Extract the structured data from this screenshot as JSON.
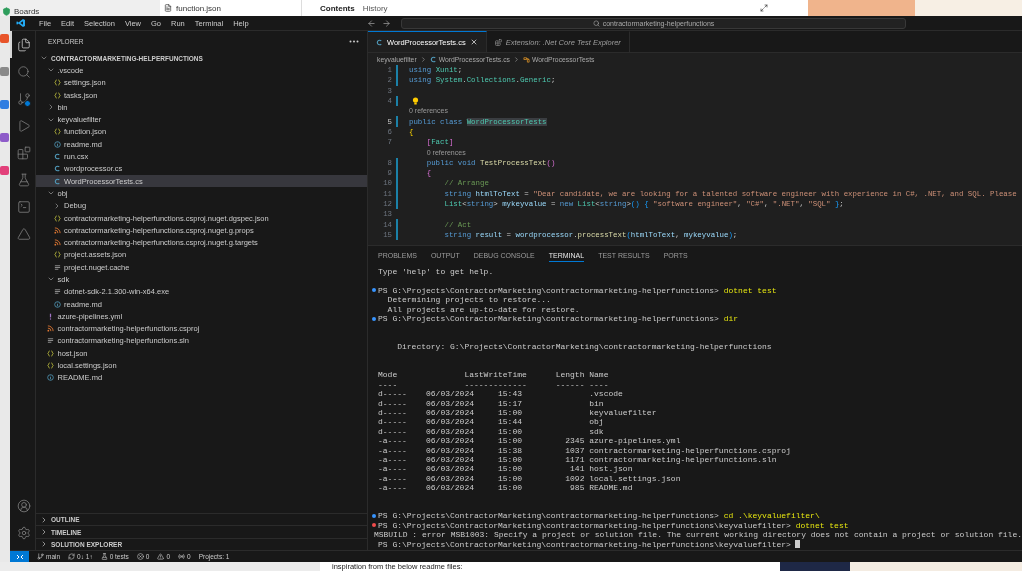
{
  "background": {
    "top_left": "Boards",
    "file_tab": "function.json",
    "tabs": [
      {
        "label": "Contents",
        "selected": true
      },
      {
        "label": "History",
        "selected": false
      }
    ],
    "bottom_text": "inspiration from the below readme files:"
  },
  "menu": [
    "File",
    "Edit",
    "Selection",
    "View",
    "Go",
    "Run",
    "Terminal",
    "Help"
  ],
  "command_center": "contractormarketing-helperfunctions",
  "activity_bar": [
    {
      "kind": "explorer",
      "selected": true
    },
    {
      "kind": "search",
      "selected": false
    },
    {
      "kind": "source_control",
      "selected": false
    },
    {
      "kind": "run",
      "selected": false
    },
    {
      "kind": "extensions",
      "selected": false
    },
    {
      "kind": "testing",
      "selected": false
    },
    {
      "kind": "terminal",
      "selected": false
    },
    {
      "kind": "azure",
      "selected": false
    }
  ],
  "activity_bar_bottom": [
    {
      "kind": "accounts"
    },
    {
      "kind": "settings"
    }
  ],
  "explorer": {
    "title": "EXPLORER",
    "tree": [
      {
        "kind": "root",
        "name": "CONTRACTORMARKETING-HELPERFUNCTIONS",
        "expanded": true,
        "selected": false,
        "children": [
          {
            "kind": "folder",
            "name": ".vscode",
            "expanded": true,
            "selected": false,
            "children": [
              {
                "kind": "json",
                "name": "settings.json",
                "selected": false
              },
              {
                "kind": "json",
                "name": "tasks.json",
                "selected": false
              }
            ]
          },
          {
            "kind": "folder",
            "name": "bin",
            "expanded": false,
            "selected": false
          },
          {
            "kind": "folder",
            "name": "keyvaluefilter",
            "expanded": true,
            "selected": false,
            "children": [
              {
                "kind": "json",
                "name": "function.json",
                "selected": false
              },
              {
                "kind": "info",
                "name": "readme.md",
                "selected": false
              },
              {
                "kind": "csharp",
                "name": "run.csx",
                "selected": false
              },
              {
                "kind": "csharp",
                "name": "wordprocessor.cs",
                "selected": false
              },
              {
                "kind": "csharp",
                "name": "WordProcessorTests.cs",
                "selected": true
              }
            ]
          },
          {
            "kind": "folder",
            "name": "obj",
            "expanded": true,
            "selected": false,
            "children": [
              {
                "kind": "folder",
                "name": "Debug",
                "expanded": false,
                "selected": false
              },
              {
                "kind": "json",
                "name": "contractormarketing-helperfunctions.csproj.nuget.dgspec.json",
                "selected": false
              },
              {
                "kind": "xml",
                "name": "contractormarketing-helperfunctions.csproj.nuget.g.props",
                "selected": false
              },
              {
                "kind": "xml",
                "name": "contractormarketing-helperfunctions.csproj.nuget.g.targets",
                "selected": false
              },
              {
                "kind": "json",
                "name": "project.assets.json",
                "selected": false
              },
              {
                "kind": "text",
                "name": "project.nuget.cache",
                "selected": false
              }
            ]
          },
          {
            "kind": "folder",
            "name": "sdk",
            "expanded": true,
            "selected": false,
            "children": [
              {
                "kind": "text",
                "name": "dotnet-sdk-2.1.300-win-x64.exe",
                "selected": false
              },
              {
                "kind": "info",
                "name": "readme.md",
                "selected": false
              }
            ]
          },
          {
            "kind": "yaml",
            "name": "azure-pipelines.yml",
            "selected": false
          },
          {
            "kind": "xml",
            "name": "contractormarketing-helperfunctions.csproj",
            "selected": false
          },
          {
            "kind": "text",
            "name": "contractormarketing-helperfunctions.sln",
            "selected": false
          },
          {
            "kind": "json",
            "name": "host.json",
            "selected": false
          },
          {
            "kind": "json",
            "name": "local.settings.json",
            "selected": false
          },
          {
            "kind": "info",
            "name": "README.md",
            "selected": false
          }
        ]
      }
    ],
    "sections": [
      {
        "label": "OUTLINE",
        "expanded": false
      },
      {
        "label": "TIMELINE",
        "expanded": false
      },
      {
        "label": "SOLUTION EXPLORER",
        "expanded": false
      }
    ]
  },
  "editor": {
    "tabs": [
      {
        "label": "WordProcessorTests.cs",
        "kind": "file",
        "selected": true
      },
      {
        "label": "Extension: .Net Core Test Explorer",
        "kind": "preview",
        "selected": false
      }
    ],
    "breadcrumb": [
      {
        "kind": "folder",
        "label": "keyvaluefilter"
      },
      {
        "kind": "csharp",
        "label": "WordProcessorTests.cs"
      },
      {
        "kind": "class",
        "label": "WordProcessorTests"
      }
    ],
    "lines": [
      {
        "kind": "code",
        "number": "1",
        "modified": true,
        "tokens": [
          {
            "text": "using ",
            "kind": "k"
          },
          {
            "text": "Xunit",
            "kind": "t"
          },
          {
            "text": ";",
            "kind": "p"
          }
        ]
      },
      {
        "kind": "code",
        "number": "2",
        "modified": true,
        "tokens": [
          {
            "text": "using ",
            "kind": "k"
          },
          {
            "text": "System",
            "kind": "t"
          },
          {
            "text": ".",
            "kind": "p"
          },
          {
            "text": "Collections",
            "kind": "t"
          },
          {
            "text": ".",
            "kind": "p"
          },
          {
            "text": "Generic",
            "kind": "t"
          },
          {
            "text": ";",
            "kind": "p"
          }
        ]
      },
      {
        "kind": "code",
        "number": "3",
        "modified": false
      },
      {
        "kind": "lightbulb",
        "number": "4",
        "modified": true
      },
      {
        "kind": "codelens",
        "text": "0 references"
      },
      {
        "kind": "code",
        "number": "5",
        "modified": true,
        "tokens": [
          {
            "text": "public class ",
            "kind": "k"
          },
          {
            "text": "WordProcessorTests",
            "kind": "h"
          }
        ]
      },
      {
        "kind": "code",
        "number": "6",
        "modified": false,
        "tokens": [
          {
            "text": "{",
            "kind": "b1"
          }
        ]
      },
      {
        "kind": "code",
        "number": "7",
        "modified": false,
        "tokens": [
          {
            "text": "    [",
            "kind": "b2"
          },
          {
            "text": "Fact",
            "kind": "t"
          },
          {
            "text": "]",
            "kind": "b2"
          }
        ]
      },
      {
        "kind": "codelens",
        "text": "0 references"
      },
      {
        "kind": "code",
        "number": "8",
        "modified": true,
        "tokens": [
          {
            "text": "    public void ",
            "kind": "k"
          },
          {
            "text": "TestProcessText",
            "kind": "f"
          },
          {
            "text": "()",
            "kind": "b2"
          }
        ]
      },
      {
        "kind": "code",
        "number": "9",
        "modified": true,
        "tokens": [
          {
            "text": "    {",
            "kind": "b2"
          }
        ]
      },
      {
        "kind": "code",
        "number": "10",
        "modified": true,
        "tokens": [
          {
            "text": "        // Arrange",
            "kind": "c"
          }
        ]
      },
      {
        "kind": "code",
        "number": "11",
        "modified": true,
        "tokens": [
          {
            "text": "        string ",
            "kind": "k"
          },
          {
            "text": "htmlToText",
            "kind": "v"
          },
          {
            "text": " = ",
            "kind": "p"
          },
          {
            "text": "\"Dear candidate, we are looking for a talented software engineer with experience in C#, .NET, and SQL. Please",
            "kind": "s"
          }
        ]
      },
      {
        "kind": "code",
        "number": "12",
        "modified": true,
        "tokens": [
          {
            "text": "        List",
            "kind": "t"
          },
          {
            "text": "<",
            "kind": "p"
          },
          {
            "text": "string",
            "kind": "k"
          },
          {
            "text": "> ",
            "kind": "p"
          },
          {
            "text": "mykeyvalue",
            "kind": "v"
          },
          {
            "text": " = ",
            "kind": "p"
          },
          {
            "text": "new ",
            "kind": "k"
          },
          {
            "text": "List",
            "kind": "t"
          },
          {
            "text": "<",
            "kind": "p"
          },
          {
            "text": "string",
            "kind": "k"
          },
          {
            "text": ">",
            "kind": "p"
          },
          {
            "text": "() {",
            "kind": "b3"
          },
          {
            "text": " \"software engineer\"",
            "kind": "s"
          },
          {
            "text": ", ",
            "kind": "p"
          },
          {
            "text": "\"C#\"",
            "kind": "s"
          },
          {
            "text": ", ",
            "kind": "p"
          },
          {
            "text": "\".NET\"",
            "kind": "s"
          },
          {
            "text": ", ",
            "kind": "p"
          },
          {
            "text": "\"SQL\" ",
            "kind": "s"
          },
          {
            "text": "}",
            "kind": "b3"
          },
          {
            "text": ";",
            "kind": "p"
          }
        ]
      },
      {
        "kind": "code",
        "number": "13",
        "modified": false
      },
      {
        "kind": "code",
        "number": "14",
        "modified": true,
        "tokens": [
          {
            "text": "        // Act",
            "kind": "c"
          }
        ]
      },
      {
        "kind": "code",
        "number": "15",
        "modified": true,
        "tokens": [
          {
            "text": "        string ",
            "kind": "k"
          },
          {
            "text": "result",
            "kind": "v"
          },
          {
            "text": " = ",
            "kind": "p"
          },
          {
            "text": "wordprocessor",
            "kind": "v"
          },
          {
            "text": ".",
            "kind": "p"
          },
          {
            "text": "processText",
            "kind": "f"
          },
          {
            "text": "(",
            "kind": "b3"
          },
          {
            "text": "htmlToText",
            "kind": "v"
          },
          {
            "text": ", ",
            "kind": "p"
          },
          {
            "text": "mykeyvalue",
            "kind": "v"
          },
          {
            "text": ")",
            "kind": "b3"
          },
          {
            "text": ";",
            "kind": "p"
          }
        ]
      }
    ]
  },
  "panel": {
    "tabs": [
      {
        "label": "PROBLEMS",
        "selected": false
      },
      {
        "label": "OUTPUT",
        "selected": false
      },
      {
        "label": "DEBUG CONSOLE",
        "selected": false
      },
      {
        "label": "TERMINAL",
        "selected": true
      },
      {
        "label": "TEST RESULTS",
        "selected": false
      },
      {
        "label": "PORTS",
        "selected": false
      }
    ],
    "terminal": [
      {
        "kind": "output",
        "text": "Type 'help' to get help."
      },
      {
        "kind": "blank"
      },
      {
        "kind": "prompt",
        "color": "#3794ff",
        "path": "PS G:\\Projects\\ContractorMarketing\\contractormarketing-helperfunctions>",
        "command": "dotnet test"
      },
      {
        "kind": "output",
        "text": "  Determining projects to restore..."
      },
      {
        "kind": "output",
        "text": "  All projects are up-to-date for restore."
      },
      {
        "kind": "prompt",
        "color": "#3794ff",
        "path": "PS G:\\Projects\\ContractorMarketing\\contractormarketing-helperfunctions>",
        "command": "dir"
      },
      {
        "kind": "blank"
      },
      {
        "kind": "blank"
      },
      {
        "kind": "output",
        "text": "    Directory: G:\\Projects\\ContractorMarketing\\contractormarketing-helperfunctions"
      },
      {
        "kind": "blank"
      },
      {
        "kind": "blank"
      },
      {
        "kind": "output",
        "text": "Mode              LastWriteTime      Length Name"
      },
      {
        "kind": "output",
        "text": "----              -------------      ------ ----"
      },
      {
        "kind": "output",
        "text": "d-----    06/03/2024     15:43              .vscode"
      },
      {
        "kind": "output",
        "text": "d-----    06/03/2024     15:17              bin"
      },
      {
        "kind": "output",
        "text": "d-----    06/03/2024     15:00              keyvaluefilter"
      },
      {
        "kind": "output",
        "text": "d-----    06/03/2024     15:44              obj"
      },
      {
        "kind": "output",
        "text": "d-----    06/03/2024     15:00              sdk"
      },
      {
        "kind": "output",
        "text": "-a----    06/03/2024     15:00         2345 azure-pipelines.yml"
      },
      {
        "kind": "output",
        "text": "-a----    06/03/2024     15:38         1037 contractormarketing-helperfunctions.csproj"
      },
      {
        "kind": "output",
        "text": "-a----    06/03/2024     15:00         1171 contractormarketing-helperfunctions.sln"
      },
      {
        "kind": "output",
        "text": "-a----    06/03/2024     15:00          141 host.json"
      },
      {
        "kind": "output",
        "text": "-a----    06/03/2024     15:00         1092 local.settings.json"
      },
      {
        "kind": "output",
        "text": "-a----    06/03/2024     15:00          985 README.md"
      },
      {
        "kind": "blank"
      },
      {
        "kind": "blank"
      },
      {
        "kind": "prompt",
        "color": "#3794ff",
        "path": "PS G:\\Projects\\ContractorMarketing\\contractormarketing-helperfunctions>",
        "command": "cd .\\keyvaluefilter\\"
      },
      {
        "kind": "prompt",
        "color": "#f14c4c",
        "path": "PS G:\\Projects\\ContractorMarketing\\contractormarketing-helperfunctions\\keyvaluefilter>",
        "command": "dotnet test"
      },
      {
        "kind": "output",
        "text": "MSBUILD : error MSB1003: Specify a project or solution file. The current working directory does not contain a project or solution file."
      },
      {
        "kind": "input",
        "path": "PS G:\\Projects\\ContractorMarketing\\contractormarketing-helperfunctions\\keyvaluefilter>"
      }
    ]
  },
  "status_bar": [
    {
      "kind": "branch",
      "text": "main"
    },
    {
      "kind": "sync",
      "text": "0↓ 1↑"
    },
    {
      "kind": "tests",
      "text": "0 tests"
    },
    {
      "kind": "errors",
      "text": "0"
    },
    {
      "kind": "warnings",
      "text": "0"
    },
    {
      "kind": "ports",
      "text": "0"
    },
    {
      "kind": "plain",
      "text": "Projects: 1"
    }
  ]
}
